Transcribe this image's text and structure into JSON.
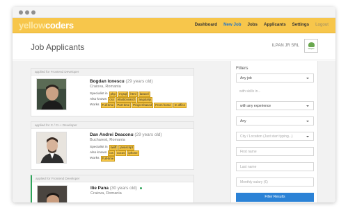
{
  "app": {
    "logo_yellow": "yellow",
    "logo_coders": "coders",
    "nav": [
      {
        "label": "Dashboard"
      },
      {
        "label": "New Job"
      },
      {
        "label": "Jobs"
      },
      {
        "label": "Applicants"
      },
      {
        "label": "Settings"
      },
      {
        "label": "Logout"
      }
    ],
    "active_nav": "New Job",
    "accent_color": "#f7c64b",
    "link_color": "#1f73c9"
  },
  "header": {
    "title": "Job Applicants",
    "company": "ILPAN JR SRL",
    "company_logo_text": "Velepiel"
  },
  "applicants": [
    {
      "applied_for": "applied for Frontend Developer",
      "name": "Bogdan Ionescu",
      "age": "(29 years old)",
      "location": "Craiova, Romania",
      "specialist_label": "Specialist in",
      "specialist": [
        "php",
        "mysql",
        "html",
        "laravel"
      ],
      "also_label": "Also knows",
      "also": [
        "css",
        "elasticsearch",
        "angularjs"
      ],
      "works_label": "Works",
      "works": [
        "Full-time",
        "Part-time",
        "Project-based",
        "From home",
        "In office"
      ]
    },
    {
      "applied_for": "applied for C / C++ Developer",
      "name": "Dan Andrei Deaconu",
      "age": "(29 years old)",
      "location": "Bucharest, Romania",
      "specialist_label": "Specialist in",
      "specialist": [
        "swift",
        "javascript"
      ],
      "also_label": "Also knows",
      "also": [
        "ios",
        "cocos",
        "iphone"
      ],
      "works_label": "Works",
      "works": [
        "Full-time"
      ]
    },
    {
      "applied_for": "applied for Frontend Developer",
      "name": "Ilie Pana",
      "age": "(30 years old)",
      "location": "Craiova, Romania"
    }
  ],
  "filters": {
    "title": "Filters",
    "job": "Any job",
    "skills_placeholder": "with skills in...",
    "experience": "with any experience",
    "type": "Any",
    "city_placeholder": "City / Location (Just start typing...)",
    "first_name_placeholder": "First name",
    "last_name_placeholder": "Last name",
    "salary_placeholder": "Monthly salary (€)",
    "button": "Filter Results"
  }
}
